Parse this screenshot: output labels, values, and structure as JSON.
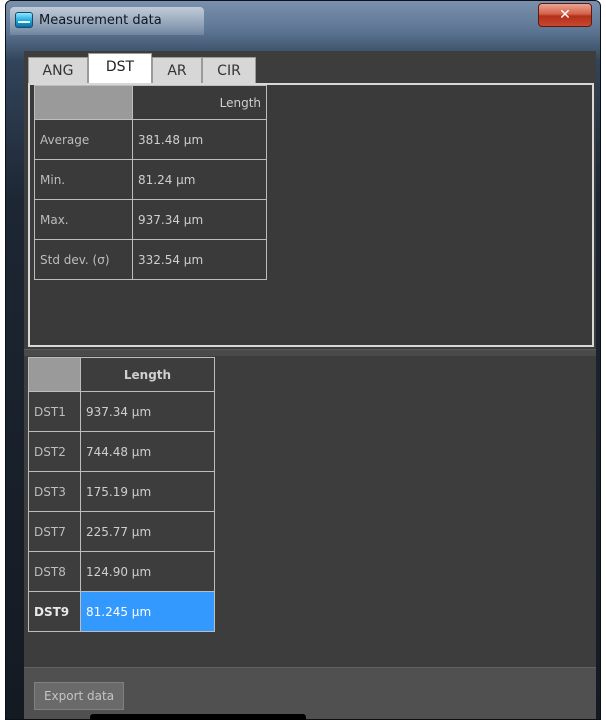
{
  "window": {
    "title": "Measurement data",
    "close_glyph": "✕",
    "icon": "measurement-app-icon"
  },
  "tabs": [
    {
      "label": "ANG",
      "active": false
    },
    {
      "label": "DST",
      "active": true
    },
    {
      "label": "AR",
      "active": false
    },
    {
      "label": "CIR",
      "active": false
    }
  ],
  "summary": {
    "header": "Length",
    "rows": [
      {
        "label": "Average",
        "value": "381.48 µm"
      },
      {
        "label": "Min.",
        "value": "81.24 µm"
      },
      {
        "label": "Max.",
        "value": "937.34 µm"
      },
      {
        "label": "Std dev. (σ)",
        "value": "332.54 µm"
      }
    ]
  },
  "details": {
    "header": "Length",
    "rows": [
      {
        "label": "DST1",
        "value": "937.34 µm",
        "selected": false
      },
      {
        "label": "DST2",
        "value": "744.48 µm",
        "selected": false
      },
      {
        "label": "DST3",
        "value": "175.19 µm",
        "selected": false
      },
      {
        "label": "DST7",
        "value": "225.77 µm",
        "selected": false
      },
      {
        "label": "DST8",
        "value": "124.90 µm",
        "selected": false
      },
      {
        "label": "DST9",
        "value": "81.245 µm",
        "selected": true
      }
    ]
  },
  "footer": {
    "export_label": "Export data"
  },
  "colors": {
    "selection": "#3399ff",
    "panel": "#3d3d3d",
    "close_button": "#c9482f"
  }
}
